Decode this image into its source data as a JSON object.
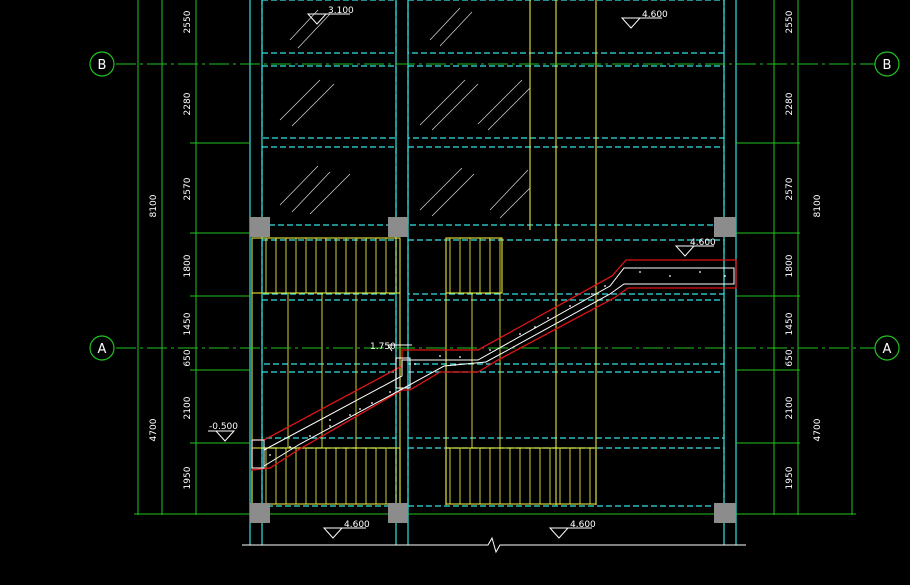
{
  "drawing": {
    "axes": [
      {
        "label": "B",
        "side": "left"
      },
      {
        "label": "B",
        "side": "right"
      },
      {
        "label": "A",
        "side": "left"
      },
      {
        "label": "A",
        "side": "right"
      }
    ],
    "dims_left": [
      "2550",
      "2280",
      "2570",
      "1800",
      "1450",
      "650",
      "2100",
      "1950"
    ],
    "dims_right": [
      "2550",
      "2280",
      "2570",
      "1800",
      "1450",
      "650",
      "2100",
      "1950"
    ],
    "dim_totals": {
      "upper": "8100",
      "lower": "4700"
    },
    "elevations": {
      "top_left": "3.100",
      "top_right": "4.600",
      "upper_landing": "4.600",
      "mid_landing": "1.750",
      "start": "-0.500",
      "bottom_left": "4.600",
      "bottom_right": "4.600"
    },
    "colors": {
      "background": "#000000",
      "axis": "#21c221",
      "column": "#8c8c8c",
      "wall": "#34e3e3",
      "stair": "#e6e63c",
      "section": "#e01414",
      "text": "#ffffff",
      "hatch": "#ffffff"
    }
  }
}
